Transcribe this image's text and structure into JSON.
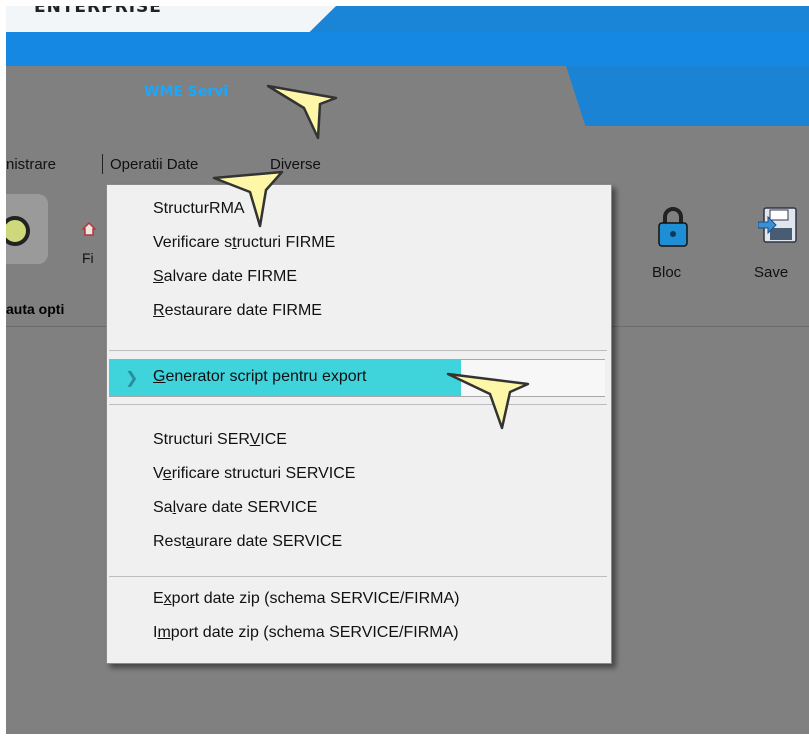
{
  "app": {
    "logo_text": "ENTERPRISE",
    "title": "WME Servi"
  },
  "menubar": {
    "items": [
      "nistrare",
      "Operatii Date",
      "Diverse"
    ]
  },
  "toolbar": {
    "firme_label": "Fi",
    "bloc_label": "Bloc",
    "save_label": "Save"
  },
  "search": {
    "label": "auta opti"
  },
  "dropdown": {
    "group1": [
      {
        "pre": "Structur",
        "mn": "",
        "post": "RMA"
      },
      {
        "pre": "Verificare s",
        "mn": "t",
        "post": "ructuri FIRME"
      },
      {
        "pre": "",
        "mn": "S",
        "post": "alvare date FIRME"
      },
      {
        "pre": "",
        "mn": "R",
        "post": "estaurare date FIRME"
      }
    ],
    "highlighted": {
      "pre": "",
      "mn": "G",
      "post": "enerator script pentru export"
    },
    "group2": [
      {
        "pre": "Structuri SER",
        "mn": "V",
        "post": "ICE"
      },
      {
        "pre": "V",
        "mn": "e",
        "post": "rificare structuri SERVICE"
      },
      {
        "pre": "Sa",
        "mn": "l",
        "post": "vare date SERVICE"
      },
      {
        "pre": "Rest",
        "mn": "a",
        "post": "urare date SERVICE"
      }
    ],
    "group3": [
      {
        "pre": "E",
        "mn": "x",
        "post": "port date zip (schema SERVICE/FIRMA)"
      },
      {
        "pre": "I",
        "mn": "m",
        "post": "port date zip (schema SERVICE/FIRMA)"
      }
    ]
  },
  "colors": {
    "accent_blue": "#1588e3",
    "highlight_cyan": "#3fd3dc",
    "app_bg": "#808080"
  },
  "icons": [
    "home-icon",
    "lock-icon",
    "save-icon",
    "chevron-right-icon",
    "cursor-pointer-icon"
  ]
}
